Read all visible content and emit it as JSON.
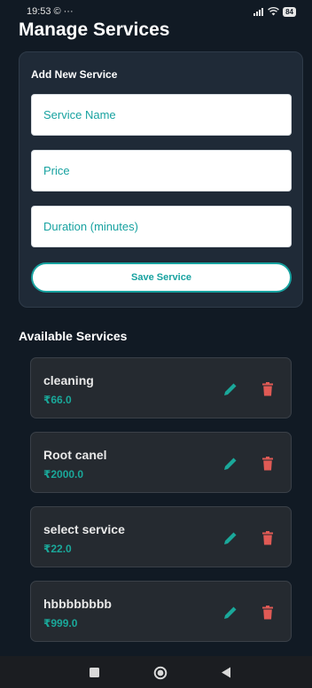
{
  "status_bar": {
    "time": "19:53",
    "notification_glyph": "©",
    "more": "···",
    "battery": "84"
  },
  "header": {
    "title": "Manage Services"
  },
  "form": {
    "title": "Add New Service",
    "name_placeholder": "Service Name",
    "price_placeholder": "Price",
    "duration_placeholder": "Duration (minutes)",
    "save_label": "Save Service"
  },
  "services": {
    "title": "Available Services",
    "items": [
      {
        "name": "cleaning",
        "price": "₹66.0"
      },
      {
        "name": "Root canel",
        "price": "₹2000.0"
      },
      {
        "name": "select service",
        "price": "₹22.0"
      },
      {
        "name": "hbbbbbbbb",
        "price": "₹999.0"
      }
    ]
  },
  "colors": {
    "background": "#111a24",
    "card": "#1f2a37",
    "accent": "#17a2a0",
    "edit": "#1aa89a",
    "delete": "#e05a55"
  },
  "icons": {
    "edit": "pencil-icon",
    "delete": "trash-icon",
    "nav_recent": "square-icon",
    "nav_home": "circle-icon",
    "nav_back": "triangle-back-icon"
  }
}
